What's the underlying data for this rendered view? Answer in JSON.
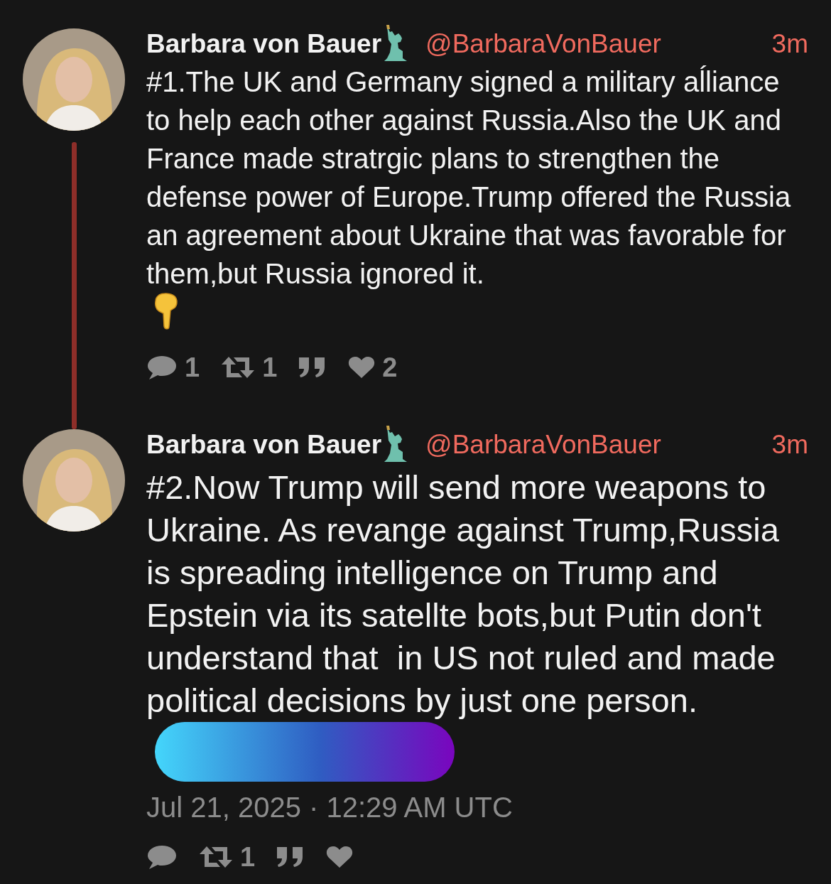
{
  "tweets": [
    {
      "author": "Barbara von Bauer",
      "handle": "@BarbaraVonBauer",
      "time": "3m",
      "text": "#1.The UK and Germany signed a military aĺliance to help each other against Russia.Also the UK and France made stratrgic plans to strengthen the defense power of Europe.Trump offered the Russia an agreement about Ukraine that was favorable for them,but Russia ignored it.",
      "pointing_emoji": true,
      "connected": true,
      "redacted": false,
      "large": false,
      "stats": {
        "replies": "1",
        "retweets": "1",
        "likes": "2"
      }
    },
    {
      "author": "Barbara von Bauer",
      "handle": "@BarbaraVonBauer",
      "time": "3m",
      "text": "#2.Now Trump will send more weapons to Ukraine. As revange against Trump,Russia is spreading intelligence on Trump and Epstein via its satellte bots,but Putin don't understand that  in US not ruled and made political decisions by just one person.",
      "pointing_emoji": false,
      "connected": false,
      "redacted": true,
      "large": true,
      "date": "Jul 21, 2025 · 12:29 AM UTC",
      "stats": {
        "retweets": "1"
      }
    }
  ]
}
